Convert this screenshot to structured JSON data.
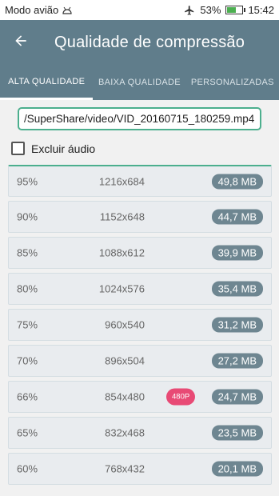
{
  "status_bar": {
    "left_text": "Modo avião",
    "battery": "53%",
    "battery_level": 0.53,
    "time": "15:42",
    "icons": [
      "android-debug-icon",
      "airplane-icon",
      "battery-icon"
    ]
  },
  "appbar": {
    "title": "Qualidade de compressão",
    "back_icon": "arrow-left-icon"
  },
  "tabs": [
    {
      "label": "ALTA QUALIDADE",
      "active": true
    },
    {
      "label": "BAIXA QUALIDADE",
      "active": false
    },
    {
      "label": "PERSONALIZADAS",
      "active": false
    }
  ],
  "file_path": "/SuperShare/video/VID_20160715_180259.mp4",
  "exclude_audio": {
    "label": "Excluir áudio",
    "checked": false
  },
  "rows": [
    {
      "pct": "95%",
      "res": "1216x684",
      "size": "49,8 MB",
      "badge": ""
    },
    {
      "pct": "90%",
      "res": "1152x648",
      "size": "44,7 MB",
      "badge": ""
    },
    {
      "pct": "85%",
      "res": "1088x612",
      "size": "39,9 MB",
      "badge": ""
    },
    {
      "pct": "80%",
      "res": "1024x576",
      "size": "35,4 MB",
      "badge": ""
    },
    {
      "pct": "75%",
      "res": "960x540",
      "size": "31,2 MB",
      "badge": ""
    },
    {
      "pct": "70%",
      "res": "896x504",
      "size": "27,2 MB",
      "badge": ""
    },
    {
      "pct": "66%",
      "res": "854x480",
      "size": "24,7 MB",
      "badge": "480P"
    },
    {
      "pct": "65%",
      "res": "832x468",
      "size": "23,5 MB",
      "badge": ""
    },
    {
      "pct": "60%",
      "res": "768x432",
      "size": "20,1 MB",
      "badge": ""
    }
  ],
  "colors": {
    "appbar": "#607d8b",
    "accent": "#4caf8e",
    "badge": "#e84a75",
    "size_pill": "#6e8691"
  }
}
